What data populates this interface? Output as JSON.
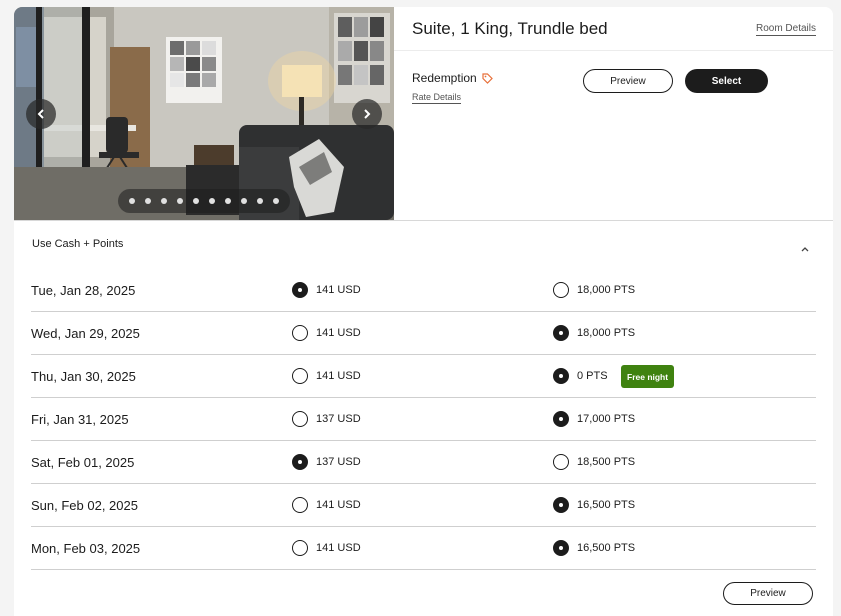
{
  "room": {
    "title": "Suite, 1 King, Trundle bed",
    "details_link": "Room Details"
  },
  "rate": {
    "name": "Redemption",
    "details_link": "Rate Details",
    "preview_label": "Preview",
    "select_label": "Select"
  },
  "gallery": {
    "dot_count": 10,
    "prev_icon": "chevron-left-icon",
    "next_icon": "chevron-right-icon"
  },
  "cash_points": {
    "label": "Use Cash + Points",
    "collapse_icon": "chevron-up-icon",
    "rows": [
      {
        "date": "Tue, Jan 28, 2025",
        "cash": "141 USD",
        "points": "18,000 PTS",
        "selected": "cash"
      },
      {
        "date": "Wed, Jan 29, 2025",
        "cash": "141 USD",
        "points": "18,000 PTS",
        "selected": "points"
      },
      {
        "date": "Thu, Jan 30, 2025",
        "cash": "141 USD",
        "points": "0 PTS",
        "selected": "points",
        "badge": "Free night"
      },
      {
        "date": "Fri, Jan 31, 2025",
        "cash": "137 USD",
        "points": "17,000 PTS",
        "selected": "points"
      },
      {
        "date": "Sat, Feb 01, 2025",
        "cash": "137 USD",
        "points": "18,500 PTS",
        "selected": "cash"
      },
      {
        "date": "Sun, Feb 02, 2025",
        "cash": "141 USD",
        "points": "16,500 PTS",
        "selected": "points"
      },
      {
        "date": "Mon, Feb 03, 2025",
        "cash": "141 USD",
        "points": "16,500 PTS",
        "selected": "points"
      }
    ],
    "preview_label": "Preview"
  },
  "colors": {
    "primary": "#1c1c1c",
    "badge_green": "#3f8210",
    "tag_icon": "#e8703a"
  }
}
